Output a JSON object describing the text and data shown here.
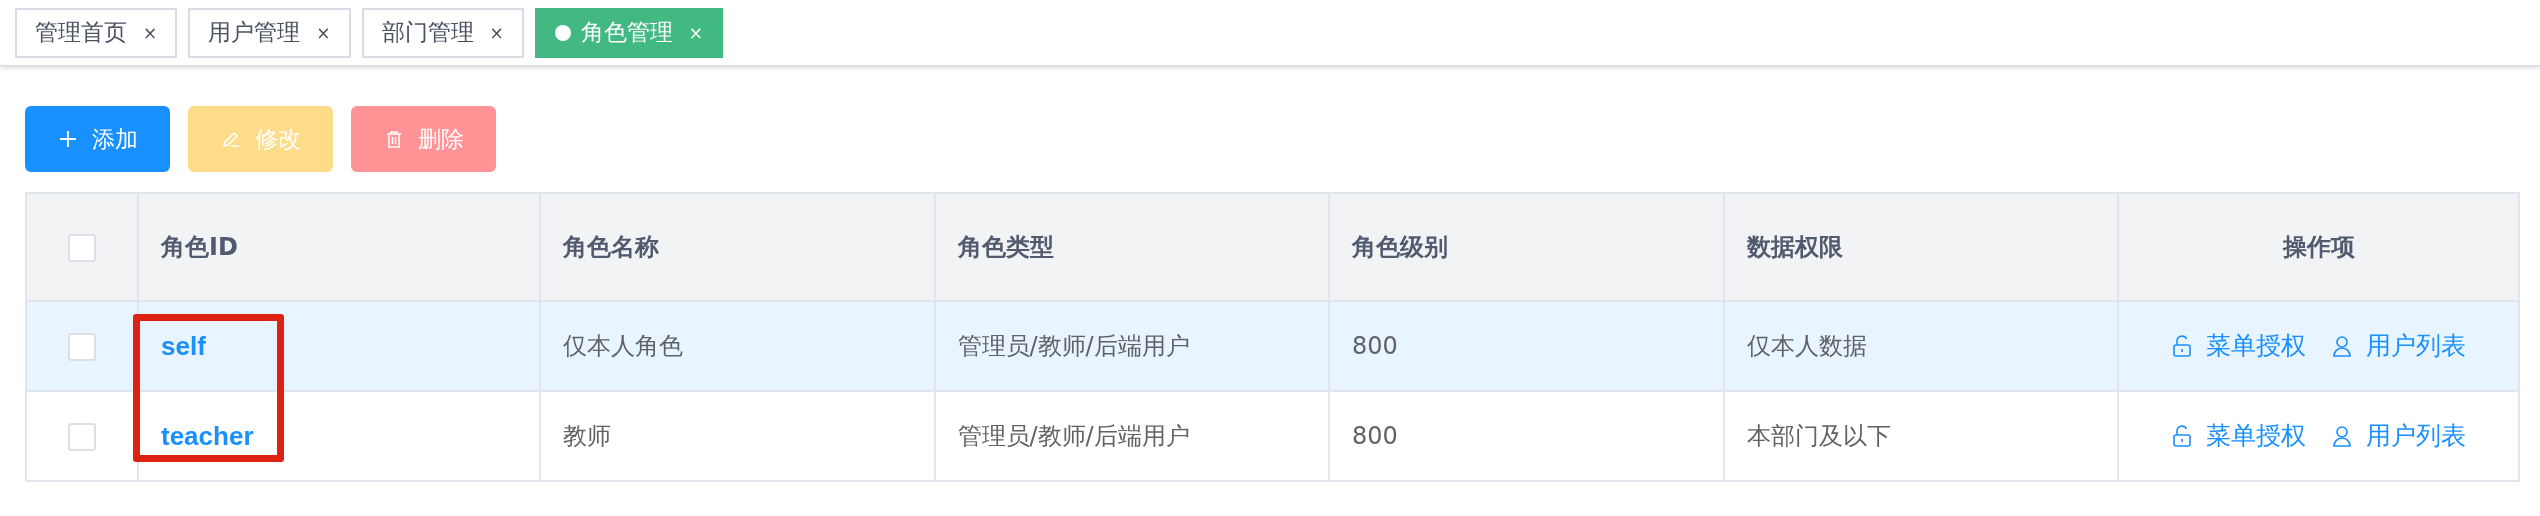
{
  "tabs": [
    {
      "label": "管理首页",
      "close": "×",
      "selected": false
    },
    {
      "label": "用户管理",
      "close": "×",
      "selected": false
    },
    {
      "label": "部门管理",
      "close": "×",
      "selected": false
    },
    {
      "label": "角色管理",
      "close": "×",
      "selected": true
    }
  ],
  "toolbar": [
    {
      "kind": "add",
      "label": "添加",
      "disabled": false
    },
    {
      "kind": "edit",
      "label": "修改",
      "disabled": true
    },
    {
      "kind": "delete",
      "label": "删除",
      "disabled": true
    }
  ],
  "table": {
    "select_all_checked": false,
    "columns": [
      "角色ID",
      "角色名称",
      "角色类型",
      "角色级别",
      "数据权限",
      "操作项"
    ],
    "rows": [
      {
        "checked": false,
        "hovered": true,
        "id": "self",
        "name": "仅本人角色",
        "type": "管理员/教师/后端用户",
        "level": "800",
        "data_scope": "仅本人数据",
        "actions": [
          {
            "kind": "lock",
            "label": "菜单授权"
          },
          {
            "kind": "user",
            "label": "用户列表"
          }
        ]
      },
      {
        "checked": false,
        "hovered": false,
        "id": "teacher",
        "name": "教师",
        "type": "管理员/教师/后端用户",
        "level": "800",
        "data_scope": "本部门及以下",
        "actions": [
          {
            "kind": "lock",
            "label": "菜单授权"
          },
          {
            "kind": "user",
            "label": "用户列表"
          }
        ]
      }
    ]
  },
  "annotation": {
    "kind": "frame",
    "color": "#dd2211"
  }
}
